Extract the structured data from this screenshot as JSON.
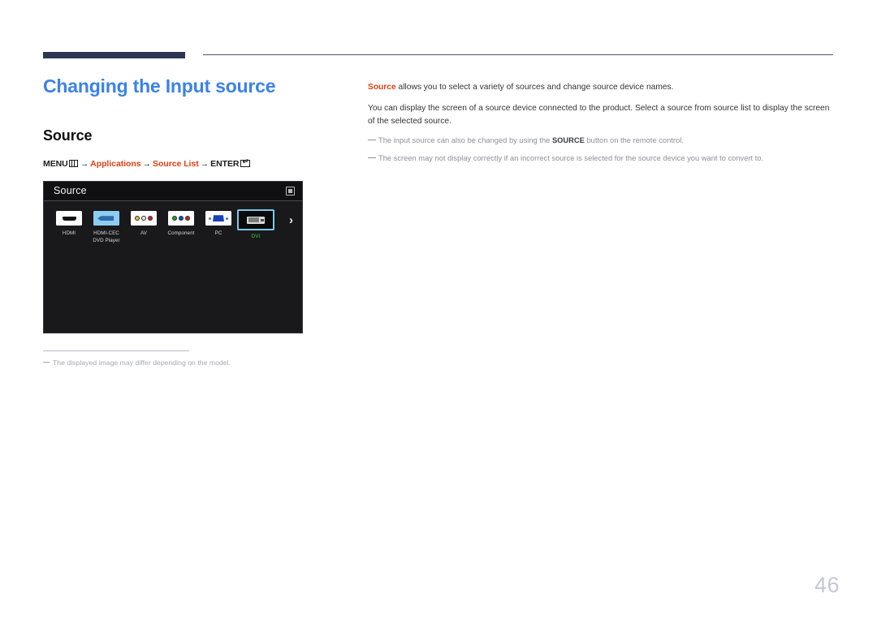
{
  "document": {
    "page_number": "46",
    "title": "Changing the Input source",
    "section_title": "Source",
    "accent_color": "#3b82e8",
    "highlight_color": "#e03e13",
    "rule_color": "#2e3552"
  },
  "menu_path": {
    "menu_label": "MENU",
    "menu_icon": "menu-grid-icon",
    "arrow1": "→",
    "item1": "Applications",
    "arrow2": "→",
    "item2": "Source List",
    "arrow3": "→",
    "enter_label": "ENTER",
    "enter_icon": "enter-key-icon"
  },
  "tv_panel": {
    "header_title": "Source",
    "header_icon": "return-exit-icon",
    "next_arrow_icon": "chevron-right-icon",
    "sources": [
      {
        "label": "HDMI",
        "icon": "hdmi-port-icon",
        "selected": false
      },
      {
        "label": "HDMI-CEC\nDVD Player",
        "label_line1": "HDMI-CEC",
        "label_line2": "DVD Player",
        "icon": "hdmi-cec-dvd-icon",
        "selected": false
      },
      {
        "label": "AV",
        "icon": "av-composite-icon",
        "selected": false
      },
      {
        "label": "Component",
        "icon": "component-video-icon",
        "selected": false
      },
      {
        "label": "PC",
        "icon": "vga-pc-icon",
        "selected": false
      },
      {
        "label": "DVI",
        "icon": "dvi-port-icon",
        "selected": true
      }
    ],
    "selected_label_color": "#3fd13f",
    "selection_border_color": "#7fc8ec"
  },
  "left_footnote": {
    "text": "The displayed image may differ depending on the model."
  },
  "right_column": {
    "paragraph1_lead": "Source",
    "paragraph1_rest": " allows you to select a variety of sources and change source device names.",
    "paragraph2": "You can display the screen of a source device connected to the product. Select a source from source list to display the screen of the selected source.",
    "note1_part1": "The input source can also be changed by using the ",
    "note1_bold": "SOURCE",
    "note1_part2": " button on the remote control.",
    "note2": "The screen may not display correctly if an incorrect source is selected for the source device you want to convert to."
  }
}
